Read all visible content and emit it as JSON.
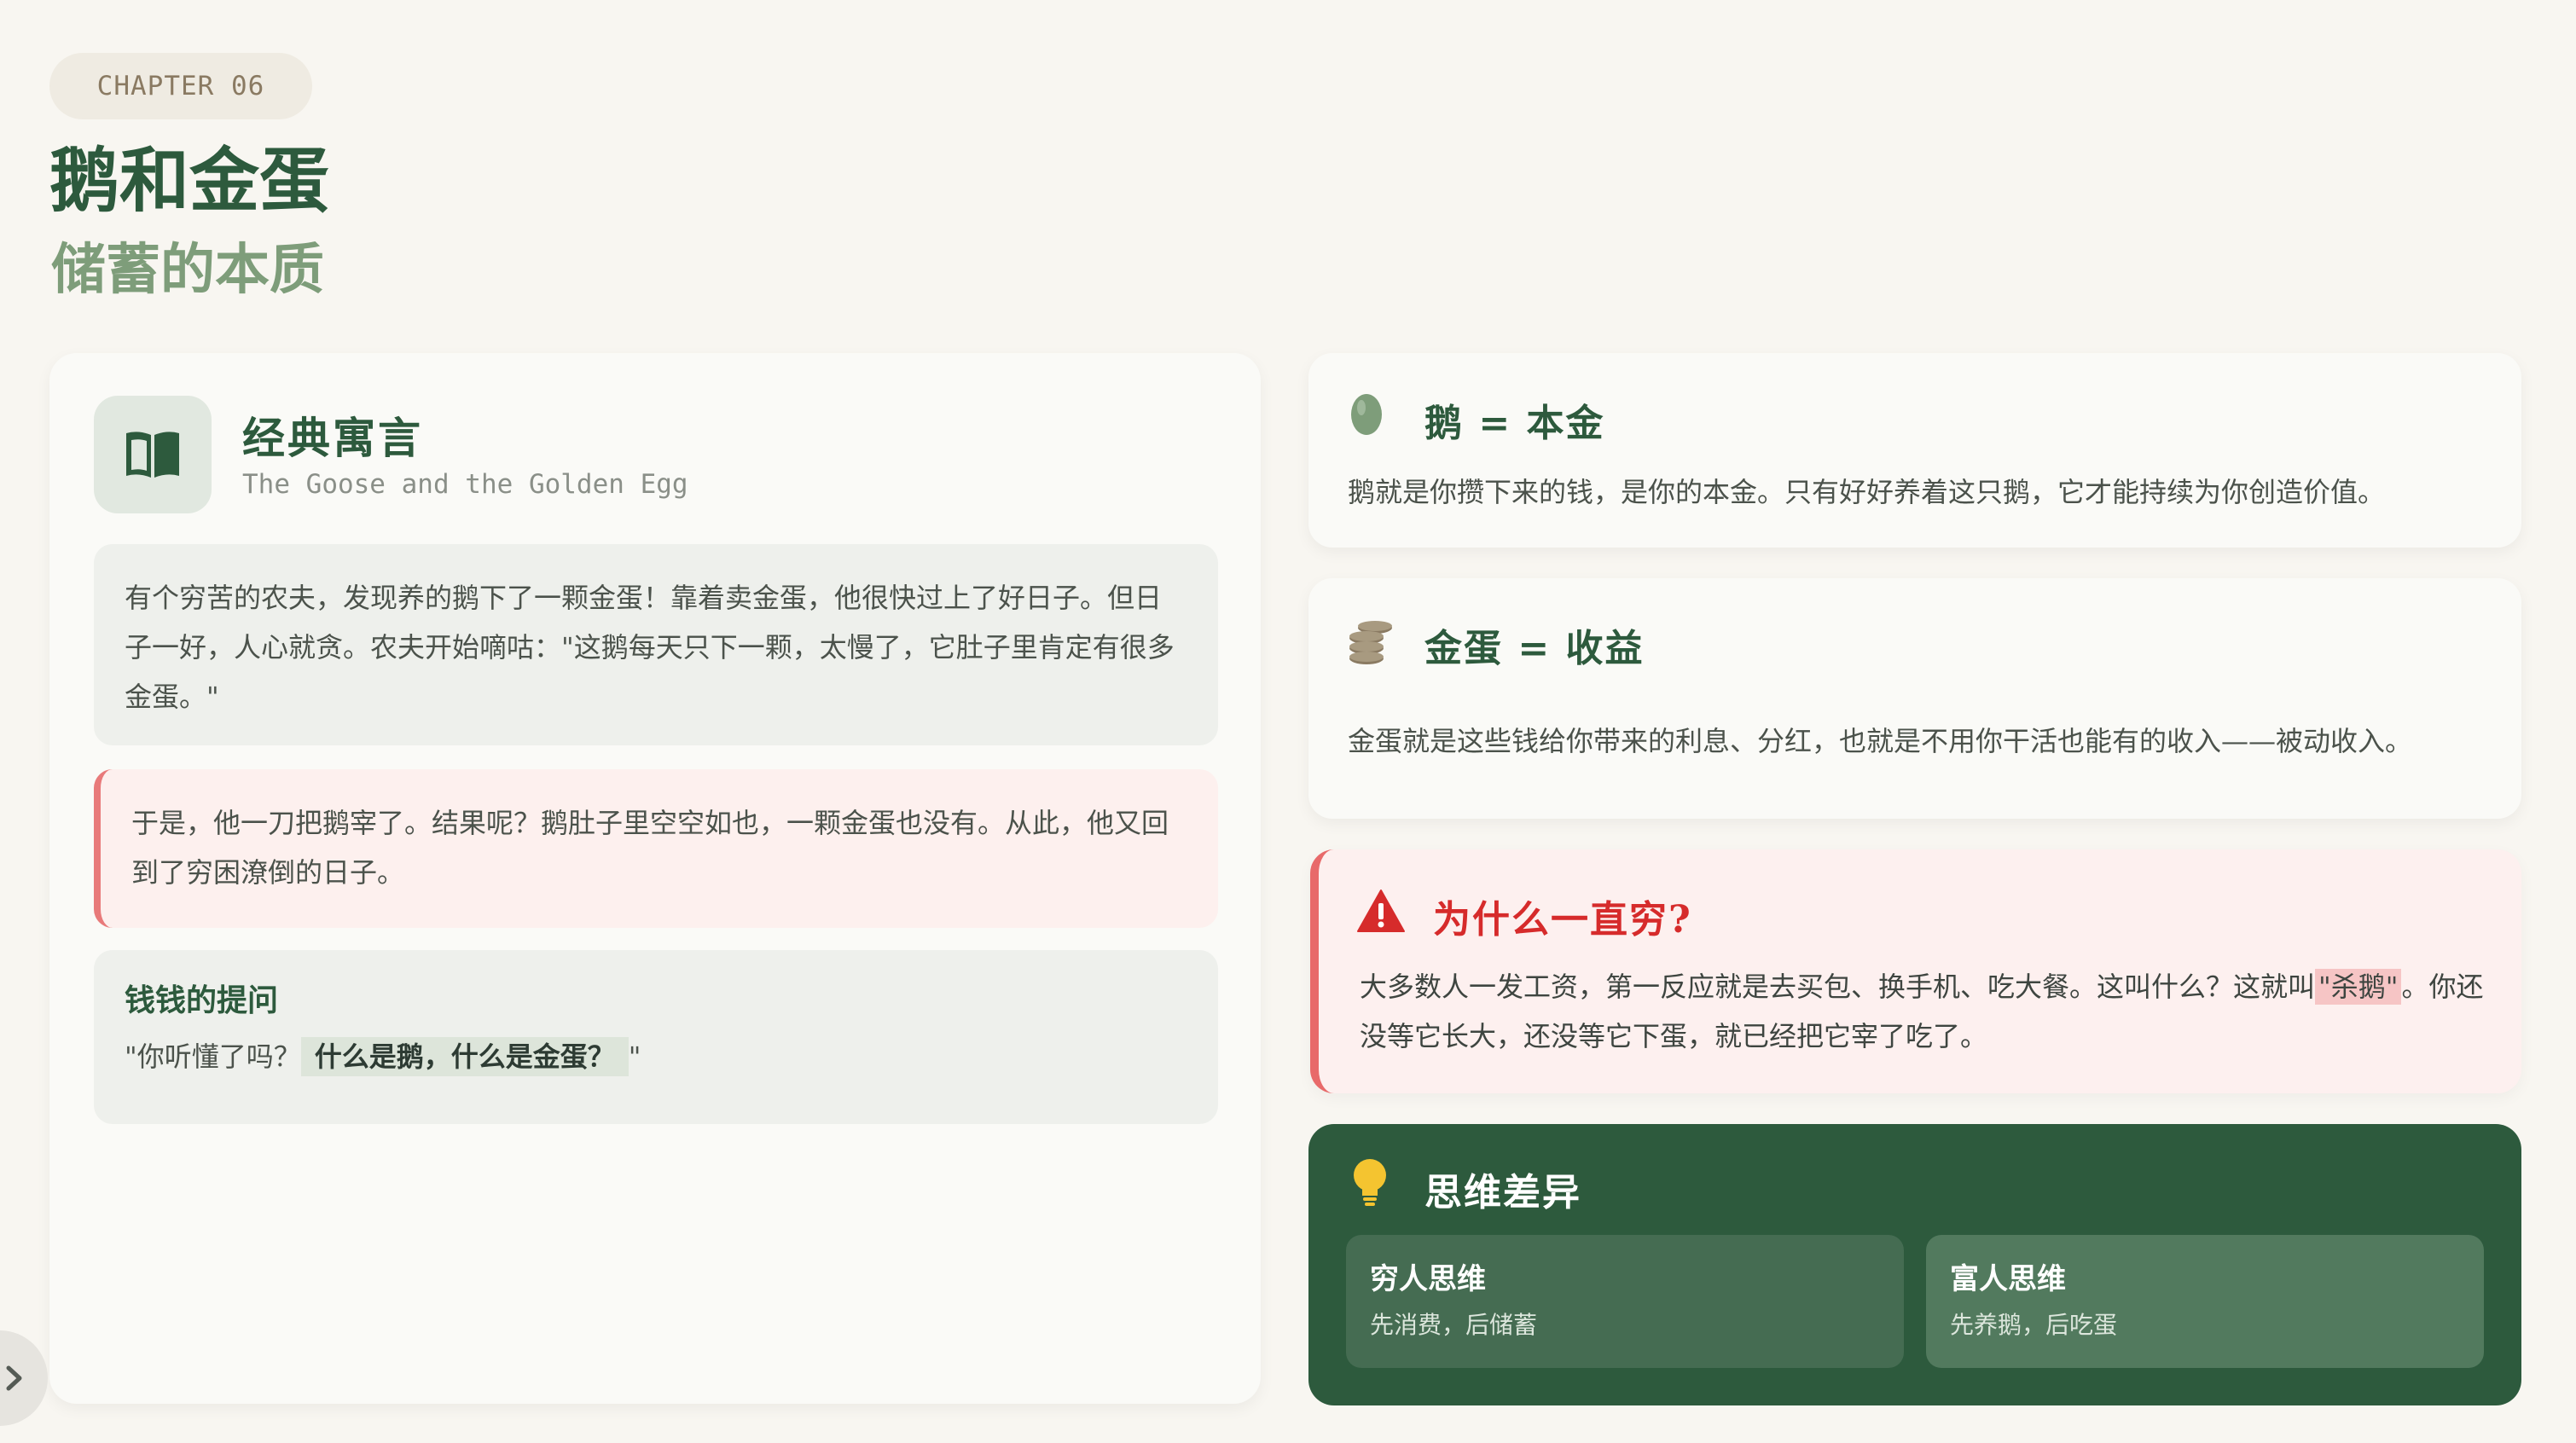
{
  "header": {
    "chapter": "CHAPTER 06",
    "title": "鹅和金蛋",
    "subtitle": "储蓄的本质"
  },
  "fable": {
    "icon": "open-book-icon",
    "title": "经典寓言",
    "title_en": "The Goose and the Golden Egg",
    "paragraph1": "有个穷苦的农夫，发现养的鹅下了一颗金蛋！靠着卖金蛋，他很快过上了好日子。但日子一好，人心就贪。农夫开始嘀咕：\"这鹅每天只下一颗，太慢了，它肚子里肯定有很多金蛋。\"",
    "paragraph2": "于是，他一刀把鹅宰了。结果呢？鹅肚子里空空如也，一颗金蛋也没有。从此，他又回到了穷困潦倒的日子。",
    "question_title": "钱钱的提问",
    "question_prefix": "\"你听懂了吗？",
    "question_highlight": "什么是鹅，什么是金蛋？",
    "question_suffix": "\""
  },
  "goose": {
    "icon": "egg-icon",
    "title": "鹅 = 本金",
    "text": "鹅就是你攒下来的钱，是你的本金。只有好好养着这只鹅，它才能持续为你创造价值。"
  },
  "egg": {
    "icon": "coins-icon",
    "title": "金蛋 = 收益",
    "text": "金蛋就是这些钱给你带来的利息、分红，也就是不用你干活也能有的收入——被动收入。"
  },
  "warning": {
    "icon": "warning-icon",
    "title": "为什么一直穷?",
    "text_before": "大多数人一发工资，第一反应就是去买包、换手机、吃大餐。这叫什么？这就叫",
    "text_highlight": "\"杀鹅\"",
    "text_after": "。你还没等它长大，还没等它下蛋，就已经把它宰了吃了。",
    "accent": "#d62b2b"
  },
  "mindset": {
    "icon": "lightbulb-icon",
    "title": "思维差异",
    "poor_title": "穷人思维",
    "poor_text": "先消费，后储蓄",
    "rich_title": "富人思维",
    "rich_text": "先养鹅，后吃蛋",
    "accent": "#2d5a3d"
  },
  "nav": {
    "toggle_icon": "chevron-right-icon"
  }
}
